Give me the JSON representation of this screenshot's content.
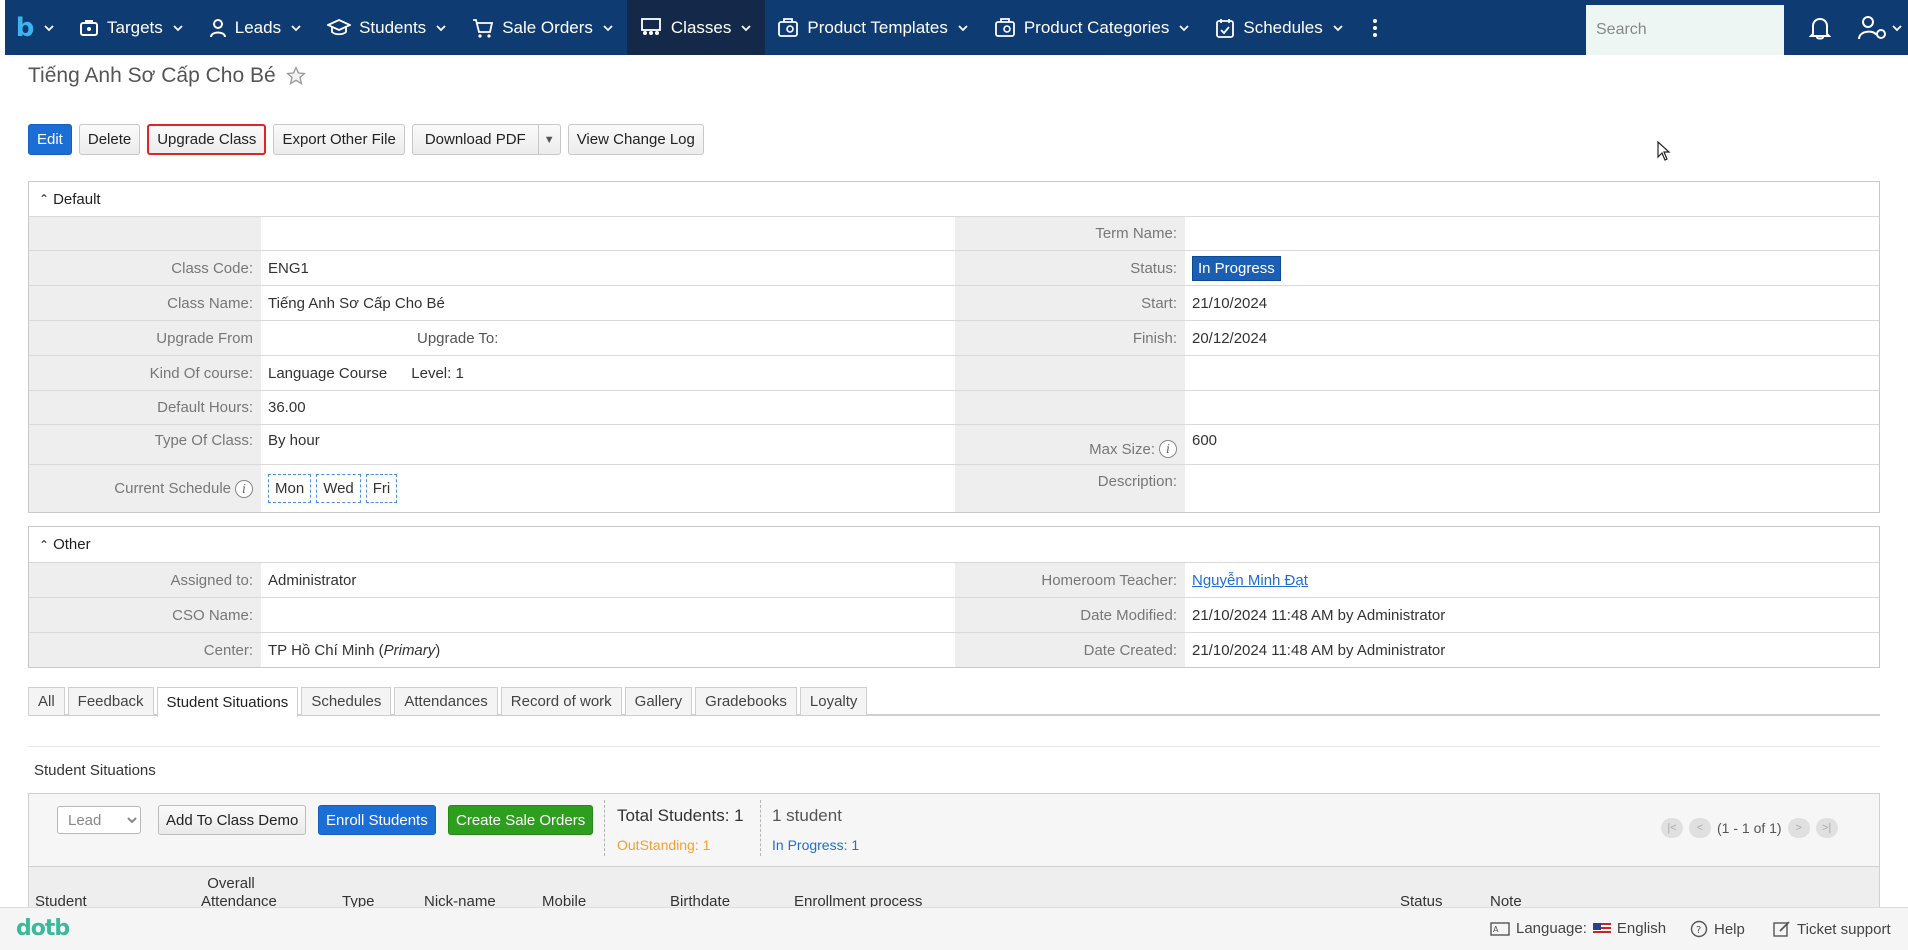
{
  "nav": {
    "items": [
      {
        "label": "Targets",
        "icon": "briefcase-icon"
      },
      {
        "label": "Leads",
        "icon": "person-icon"
      },
      {
        "label": "Students",
        "icon": "graduation-cap-icon"
      },
      {
        "label": "Sale Orders",
        "icon": "cart-icon"
      },
      {
        "label": "Classes",
        "icon": "classroom-icon",
        "active": true
      },
      {
        "label": "Product Templates",
        "icon": "box-icon"
      },
      {
        "label": "Product Categories",
        "icon": "box-icon"
      },
      {
        "label": "Schedules",
        "icon": "calendar-check-icon"
      }
    ],
    "search_placeholder": "Search"
  },
  "page": {
    "title": "Tiếng Anh Sơ Cấp Cho Bé"
  },
  "actions": {
    "edit": "Edit",
    "delete": "Delete",
    "upgrade_class": "Upgrade Class",
    "export_other_file": "Export Other File",
    "download_pdf": "Download PDF",
    "view_change_log": "View Change Log"
  },
  "default_panel": {
    "title": "Default",
    "term_name_label": "Term Name:",
    "term_name": "",
    "class_code_label": "Class Code:",
    "class_code": "ENG1",
    "status_label": "Status:",
    "status": "In Progress",
    "class_name_label": "Class Name:",
    "class_name": "Tiếng Anh Sơ Cấp Cho Bé",
    "start_label": "Start:",
    "start": "21/10/2024",
    "upgrade_from_label": "Upgrade From",
    "upgrade_to_label": "Upgrade To:",
    "finish_label": "Finish:",
    "finish": "20/12/2024",
    "kind_label": "Kind Of course:",
    "kind": "Language Course",
    "level": "Level: 1",
    "default_hours_label": "Default Hours:",
    "default_hours": "36.00",
    "type_label": "Type Of Class:",
    "type": "By hour",
    "max_size_label": "Max Size:",
    "max_size": "600",
    "current_schedule_label": "Current Schedule",
    "schedule_days": [
      "Mon",
      "Wed",
      "Fri"
    ],
    "description_label": "Description:"
  },
  "other_panel": {
    "title": "Other",
    "assigned_label": "Assigned to:",
    "assigned": "Administrator",
    "homeroom_label": "Homeroom Teacher:",
    "homeroom": "Nguyễn Minh Đạt",
    "cso_label": "CSO Name:",
    "date_modified_label": "Date Modified:",
    "date_modified": "21/10/2024 11:48 AM by Administrator",
    "center_label": "Center:",
    "center": "TP Hồ Chí Minh",
    "center_tag": "Primary",
    "date_created_label": "Date Created:",
    "date_created": "21/10/2024 11:48 AM by Administrator"
  },
  "tabs": [
    "All",
    "Feedback",
    "Student Situations",
    "Schedules",
    "Attendances",
    "Record of work",
    "Gallery",
    "Gradebooks",
    "Loyalty"
  ],
  "student_situations": {
    "title": "Student Situations",
    "filter_value": "Lead",
    "add_demo": "Add To Class Demo",
    "enroll": "Enroll Students",
    "create_so": "Create Sale Orders",
    "total": "Total Students: 1",
    "outstanding": "OutStanding: 1",
    "count": "1 student",
    "in_progress": "In Progress: 1",
    "pager": "(1 - 1 of 1)",
    "columns": [
      "Student",
      "Overall Attendance",
      "Type",
      "Nick-name",
      "Mobile",
      "Birthdate",
      "Enrollment process",
      "Status",
      "Note"
    ]
  },
  "footer": {
    "brand": "dotb",
    "language_label": "Language:",
    "language": "English",
    "help": "Help",
    "ticket": "Ticket support"
  },
  "colors": {
    "nav_bg": "#0f3b73",
    "nav_active": "#14294a",
    "primary": "#1b6ed6",
    "green": "#2e9e1f",
    "status_badge": "#1a5fb4",
    "outstanding": "#f0a030",
    "in_progress": "#1f6fd1"
  }
}
